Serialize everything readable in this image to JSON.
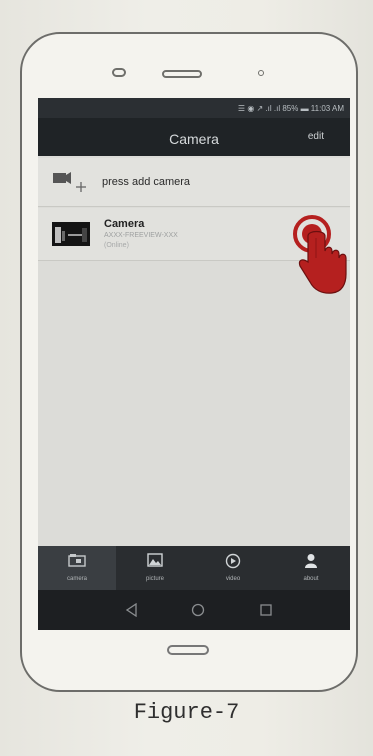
{
  "status_bar": {
    "text": "☰ ◉ ↗ .ıl .ıl 85% ▬ 11:03 AM"
  },
  "header": {
    "title": "Camera",
    "edit_label": "edit"
  },
  "add_row": {
    "label": "press add camera",
    "icon": "add-camera-icon"
  },
  "camera_row": {
    "name": "Camera",
    "uid": "AXXX-FREEVIEW-XXX",
    "status": "(Online)",
    "icon": "camera-thumbnail"
  },
  "tabs": [
    {
      "label": "camera",
      "icon": "camera-folder-icon",
      "active": true
    },
    {
      "label": "picture",
      "icon": "picture-icon",
      "active": false
    },
    {
      "label": "video",
      "icon": "video-icon",
      "active": false
    },
    {
      "label": "about",
      "icon": "person-icon",
      "active": false
    }
  ],
  "nav": {
    "back": "back-icon",
    "home": "home-icon",
    "recent": "recent-icon"
  },
  "caption": "Figure-7",
  "colors": {
    "accent_red": "#b5201f",
    "bar_dark": "#1f2326"
  }
}
